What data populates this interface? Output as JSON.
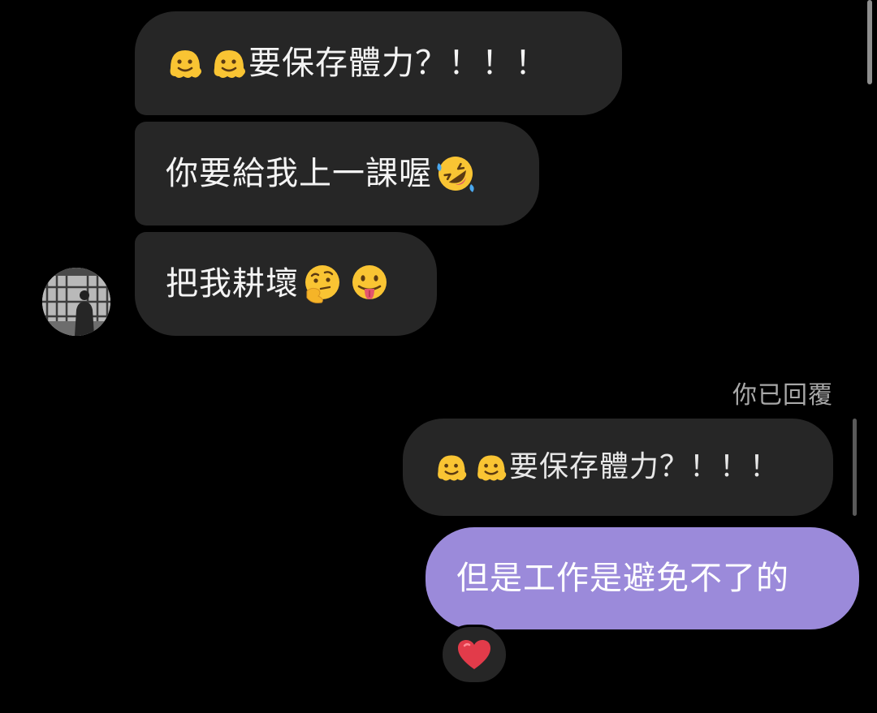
{
  "colors": {
    "background": "#000000",
    "incoming_bubble": "#262626",
    "outgoing_bubble": "#9b8ada",
    "meta_text": "#a8a8a8",
    "reaction_heart": "#e23b4a"
  },
  "messages_incoming": [
    {
      "text": "要保存體力？！！！",
      "emojis": [
        "melting-face",
        "melting-face"
      ],
      "emoji_position": "before"
    },
    {
      "text": "你要給我上一課喔",
      "emojis": [
        "rolling-on-floor-laughing"
      ],
      "emoji_position": "after"
    },
    {
      "text": "把我耕壞",
      "emojis": [
        "thinking-face",
        "tongue-out-face"
      ],
      "emoji_position": "after"
    }
  ],
  "reply": {
    "label": "你已回覆",
    "quoted_text": "要保存體力？！！！",
    "quoted_emojis": [
      "melting-face",
      "melting-face"
    ],
    "message": "但是工作是避免不了的",
    "reaction": "red-heart"
  }
}
